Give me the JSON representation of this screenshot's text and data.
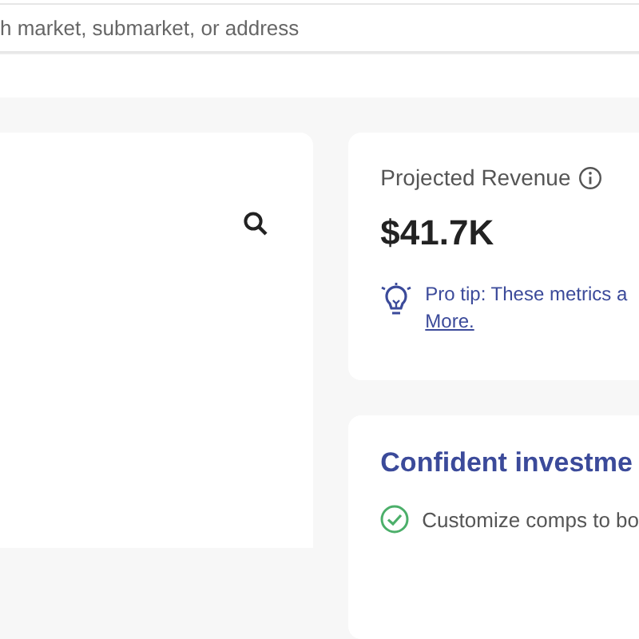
{
  "search": {
    "placeholder": "h market, submarket, or address"
  },
  "revenue_card": {
    "label": "Projected Revenue",
    "value": "$41.7K",
    "tip": "Pro tip: These metrics a",
    "tip_link": "More."
  },
  "invest_card": {
    "title": "Confident investme",
    "items": [
      {
        "text": "Customize comps to bo",
        "checked": true
      }
    ]
  }
}
